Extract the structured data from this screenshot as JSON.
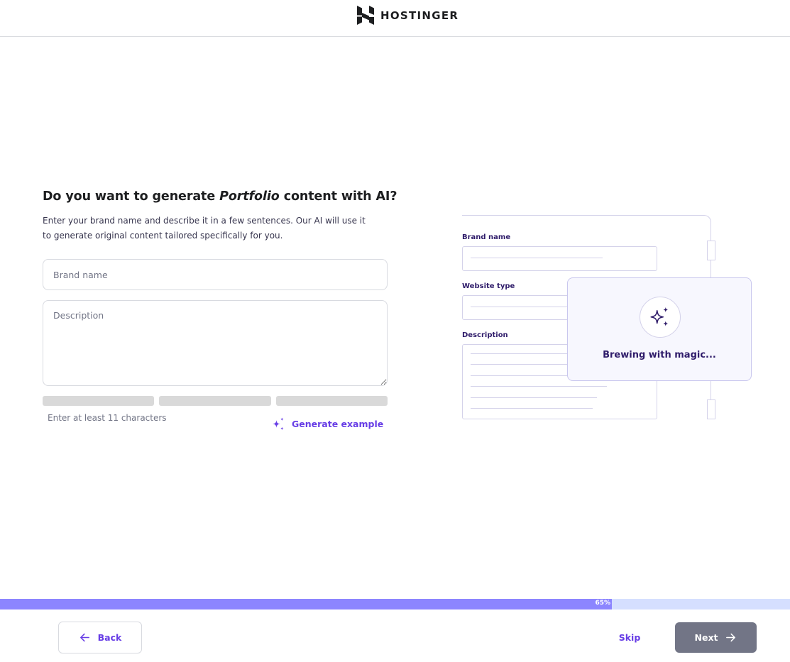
{
  "header": {
    "logo_text": "HOSTINGER"
  },
  "main": {
    "title_prefix": "Do you want to generate ",
    "title_emphasis": "Portfolio",
    "title_suffix": " content with AI?",
    "subtitle": "Enter your brand name and describe it in a few sentences. Our AI will use it to generate original content tailored specifically for you.",
    "brand_name_field": {
      "value": "",
      "placeholder": "Brand name"
    },
    "description_field": {
      "value": "",
      "placeholder": "Description"
    },
    "strength_meter": {
      "segments": 3,
      "filled": 0
    },
    "hint": "Enter at least 11 characters",
    "generate_example_label": "Generate example"
  },
  "illustration": {
    "brand_name_label": "Brand name",
    "website_type_label": "Website type",
    "description_label": "Description",
    "status_text": "Brewing with magic..."
  },
  "progress": {
    "value": 65,
    "label": "65%"
  },
  "footer": {
    "back_label": "Back",
    "skip_label": "Skip",
    "next_label": "Next"
  },
  "colors": {
    "accent": "#673de6",
    "progress_fill": "#8c85ff",
    "progress_track": "#d5dfff",
    "next_button_disabled": "#727586",
    "illustration_text": "#2f1c6a"
  },
  "icons": {
    "logo": "hostinger-logo-icon",
    "generate": "sparkles-icon",
    "back": "arrow-left-icon",
    "next": "arrow-right-icon",
    "magic": "sparkles-icon"
  }
}
